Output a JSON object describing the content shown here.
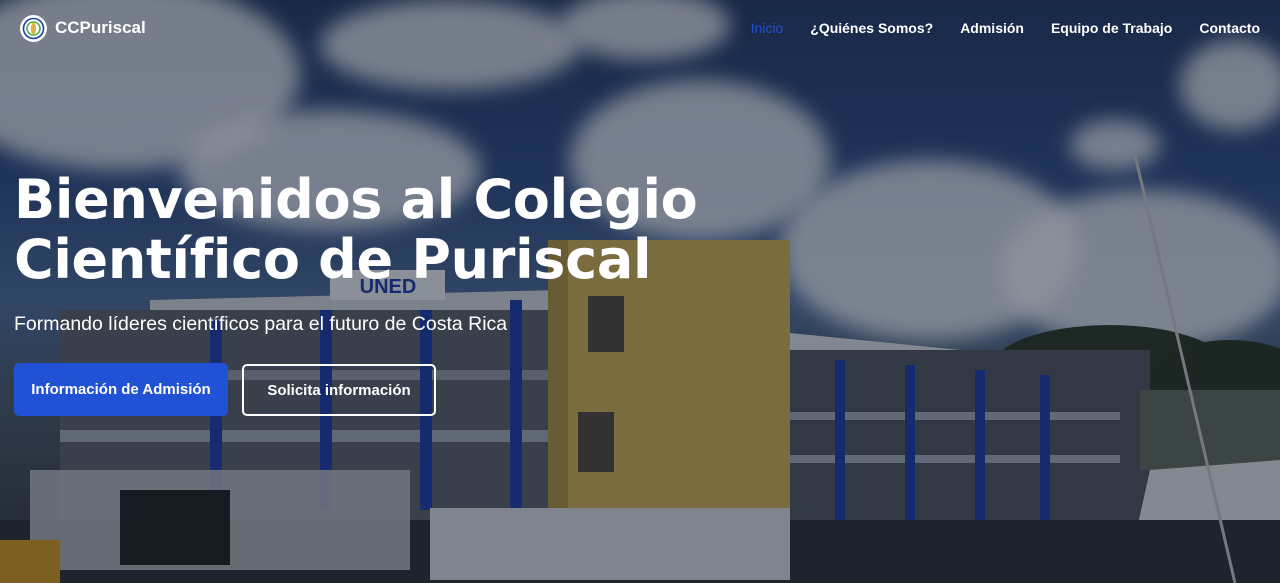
{
  "brand": {
    "name": "CCPuriscal",
    "logo_icon": "leaf-globe-logo"
  },
  "nav": {
    "items": [
      {
        "label": "Inicio",
        "active": true
      },
      {
        "label": "¿Quiénes Somos?",
        "active": false
      },
      {
        "label": "Admisión",
        "active": false
      },
      {
        "label": "Equipo de Trabajo",
        "active": false
      },
      {
        "label": "Contacto",
        "active": false
      }
    ]
  },
  "hero": {
    "title_line1": "Bienvenidos al Colegio",
    "title_line2": "Científico de Puriscal",
    "subtitle": "Formando líderes científicos para el futuro de Costa Rica",
    "primary_button": "Información de Admisión",
    "secondary_button": "Solicita información",
    "building_sign": "UNED"
  },
  "colors": {
    "accent": "#2152d6",
    "text": "#ffffff",
    "building_yellow": "#d7b85a"
  }
}
